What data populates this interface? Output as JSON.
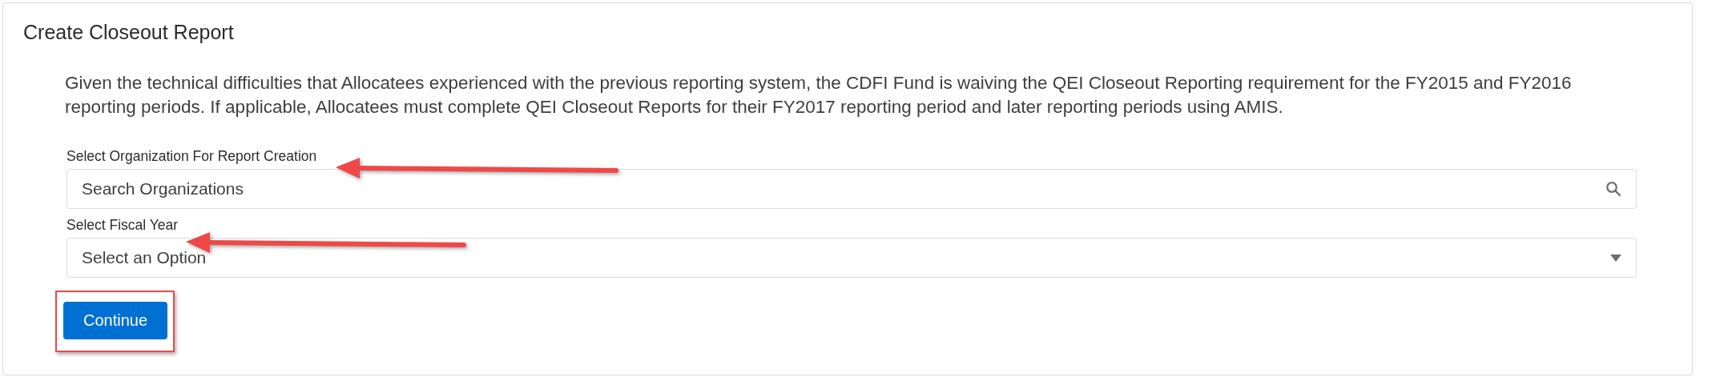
{
  "card": {
    "title": "Create Closeout Report"
  },
  "notice": "Given the technical difficulties that Allocatees experienced with the previous reporting system, the CDFI Fund is waiving the QEI Closeout Reporting requirement for the FY2015 and FY2016 reporting periods. If applicable, Allocatees must complete QEI Closeout Reports for their FY2017 reporting period and later reporting periods using AMIS.",
  "fields": [
    {
      "kind": "search",
      "label": "Select Organization For Report Creation",
      "placeholder": "Search Organizations"
    },
    {
      "kind": "select",
      "label": "Select Fiscal Year",
      "placeholder": "Select an Option"
    }
  ],
  "button": {
    "label": "Continue"
  }
}
